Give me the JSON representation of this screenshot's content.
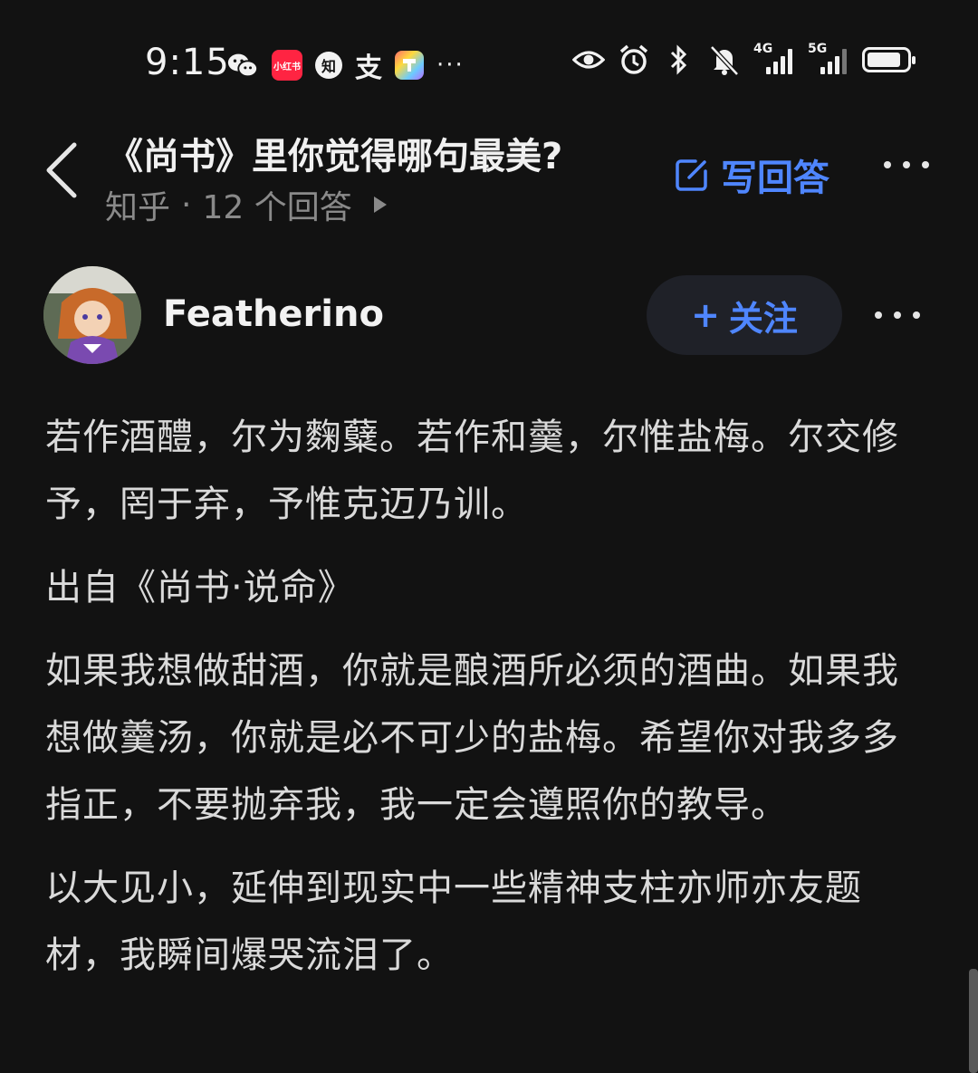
{
  "status_bar": {
    "time": "9:15",
    "left_apps": [
      {
        "name": "wechat-icon"
      },
      {
        "name": "xiaohongshu-icon",
        "label": "小红书"
      },
      {
        "name": "zhihu-icon",
        "label": "知"
      },
      {
        "name": "alipay-icon",
        "label": "支"
      },
      {
        "name": "app-icon"
      }
    ],
    "more": "···",
    "network_4g": "4G",
    "network_5g": "5G",
    "battery_level": 0.85
  },
  "header": {
    "title": "《尚书》里你觉得哪句最美?",
    "source": "知乎",
    "separator": "·",
    "answer_count": "12 个回答",
    "write_answer_label": "写回答"
  },
  "author": {
    "name": "Featherino",
    "follow_label": "关注",
    "follow_icon": "+"
  },
  "content": {
    "paragraphs": [
      "若作酒醴，尔为麴糵。若作和羹，尔惟盐梅。尔交修予，罔于弃，予惟克迈乃训。",
      "出自《尚书·说命》",
      "如果我想做甜酒，你就是酿酒所必须的酒曲。如果我想做羹汤，你就是必不可少的盐梅。希望你对我多多指正，不要抛弃我，我一定会遵照你的教导。",
      "以大见小，延伸到现实中一些精神支柱亦师亦友题材，我瞬间爆哭流泪了。"
    ]
  },
  "colors": {
    "background": "#121212",
    "accent": "#4f86ff",
    "text_primary": "#f0f0f0",
    "text_body": "#dadada",
    "text_secondary": "#8a8a8a"
  }
}
